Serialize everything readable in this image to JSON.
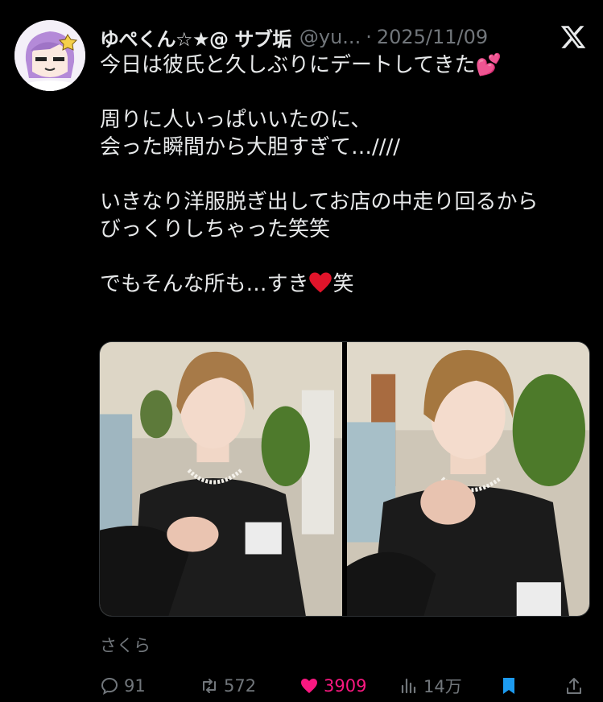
{
  "user": {
    "display_name": "ゆぺくん☆★@ サブ垢",
    "handle": "@yu...",
    "separator": "·",
    "date": "2025/11/09"
  },
  "tweet": {
    "p1": "今日は彼氏と久しぶりにデートしてきた💕",
    "p2_l1": "周りに人いっぱいいたのに、",
    "p2_l2": "会った瞬間から大胆すぎて…////",
    "p3_l1": "いきなり洋服脱ぎ出してお店の中走り回るから",
    "p3_l2": "びっくりしちゃった笑笑",
    "p4_before": "でもそんな所も…すき",
    "p4_after": "笑"
  },
  "caption": "さくら",
  "actions": {
    "reply_count": "91",
    "retweet_count": "572",
    "like_count": "3909",
    "views_count": "14万"
  },
  "icons": {
    "logo": "x-logo-icon",
    "reply": "reply-icon",
    "retweet": "retweet-icon",
    "like": "heart-icon",
    "views": "views-icon",
    "bookmark": "bookmark-icon",
    "share": "share-icon"
  },
  "colors": {
    "background": "#000000",
    "text": "#e7e9ea",
    "muted": "#71767b",
    "like": "#f91880",
    "bookmark": "#1d9bf0"
  }
}
